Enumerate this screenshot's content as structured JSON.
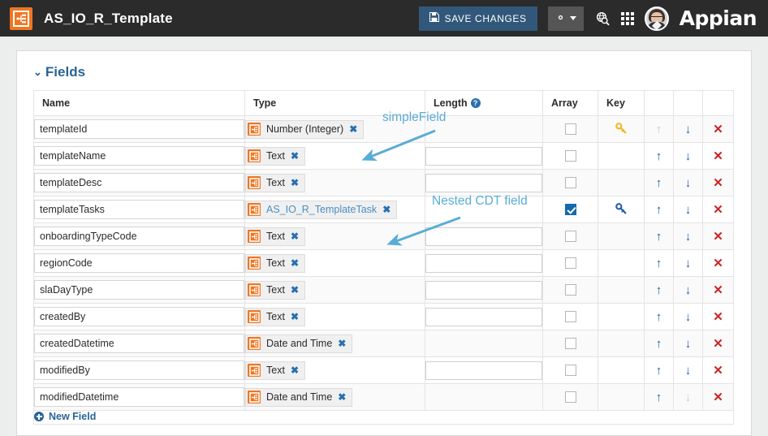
{
  "topbar": {
    "app_icon": "cdt-icon",
    "title": "AS_IO_R_Template",
    "save_label": "SAVE CHANGES",
    "save_icon": "floppy-disk-icon",
    "gear_icon": "gear-icon",
    "caret_icon": "caret-down-icon",
    "search_icon": "globe-search-icon",
    "apps_icon": "app-grid-icon",
    "avatar_icon": "user-avatar",
    "brand": "Appian",
    "colors": {
      "bar_bg": "#2b2b2b",
      "save_bg": "#31587a",
      "gear_bg": "#555556",
      "accent_orange": "#ef7622"
    }
  },
  "section": {
    "chevron": "⌄",
    "title": "Fields"
  },
  "table": {
    "headers": {
      "name": "Name",
      "type": "Type",
      "length": "Length",
      "length_help_icon": "help-icon",
      "array": "Array",
      "key": "Key",
      "up": "",
      "down": "",
      "delete": ""
    },
    "rows": [
      {
        "name": "templateId",
        "type": "Number (Integer)",
        "type_link": false,
        "length": "",
        "has_length_input": false,
        "array": false,
        "key": "primary",
        "up_enabled": false,
        "down_enabled": true
      },
      {
        "name": "templateName",
        "type": "Text",
        "type_link": false,
        "length": "",
        "has_length_input": true,
        "array": false,
        "key": "none",
        "up_enabled": true,
        "down_enabled": true
      },
      {
        "name": "templateDesc",
        "type": "Text",
        "type_link": false,
        "length": "",
        "has_length_input": true,
        "array": false,
        "key": "none",
        "up_enabled": true,
        "down_enabled": true
      },
      {
        "name": "templateTasks",
        "type": "AS_IO_R_TemplateTask",
        "type_link": true,
        "length": "",
        "has_length_input": false,
        "array": true,
        "key": "foreign",
        "up_enabled": true,
        "down_enabled": true
      },
      {
        "name": "onboardingTypeCode",
        "type": "Text",
        "type_link": false,
        "length": "",
        "has_length_input": true,
        "array": false,
        "key": "none",
        "up_enabled": true,
        "down_enabled": true
      },
      {
        "name": "regionCode",
        "type": "Text",
        "type_link": false,
        "length": "",
        "has_length_input": true,
        "array": false,
        "key": "none",
        "up_enabled": true,
        "down_enabled": true
      },
      {
        "name": "slaDayType",
        "type": "Text",
        "type_link": false,
        "length": "",
        "has_length_input": true,
        "array": false,
        "key": "none",
        "up_enabled": true,
        "down_enabled": true
      },
      {
        "name": "createdBy",
        "type": "Text",
        "type_link": false,
        "length": "",
        "has_length_input": true,
        "array": false,
        "key": "none",
        "up_enabled": true,
        "down_enabled": true
      },
      {
        "name": "createdDatetime",
        "type": "Date and Time",
        "type_link": false,
        "length": "",
        "has_length_input": false,
        "array": false,
        "key": "none",
        "up_enabled": true,
        "down_enabled": true
      },
      {
        "name": "modifiedBy",
        "type": "Text",
        "type_link": false,
        "length": "",
        "has_length_input": true,
        "array": false,
        "key": "none",
        "up_enabled": true,
        "down_enabled": true
      },
      {
        "name": "modifiedDatetime",
        "type": "Date and Time",
        "type_link": false,
        "length": "",
        "has_length_input": false,
        "array": false,
        "key": "none",
        "up_enabled": true,
        "down_enabled": false
      }
    ],
    "chip_remove_glyph": "✖",
    "up_glyph": "↑",
    "down_glyph": "↓",
    "delete_glyph": "✕",
    "new_field_label": "New Field",
    "new_field_icon": "plus-circle-icon"
  },
  "annotations": [
    {
      "id": "simpleField",
      "text": "simpleField",
      "color": "#5aacd6"
    },
    {
      "id": "nestedCDT",
      "text": "Nested CDT field",
      "color": "#5aacd6"
    }
  ]
}
